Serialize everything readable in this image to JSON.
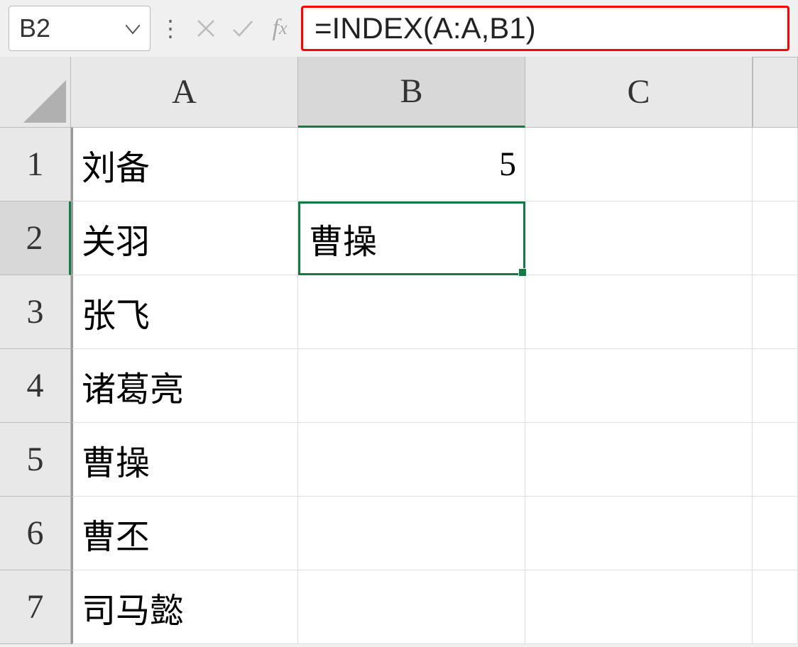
{
  "name_box": "B2",
  "formula": "=INDEX(A:A,B1)",
  "column_headers": [
    "A",
    "B",
    "C"
  ],
  "row_headers": [
    "1",
    "2",
    "3",
    "4",
    "5",
    "6",
    "7"
  ],
  "active_cell": "B2",
  "active_col": "B",
  "active_row": "2",
  "cells": {
    "A1": "刘备",
    "B1": "5",
    "A2": "关羽",
    "B2": "曹操",
    "A3": "张飞",
    "A4": "诸葛亮",
    "A5": "曹操",
    "A6": "曹丕",
    "A7": "司马懿"
  },
  "fx_label": "fx"
}
